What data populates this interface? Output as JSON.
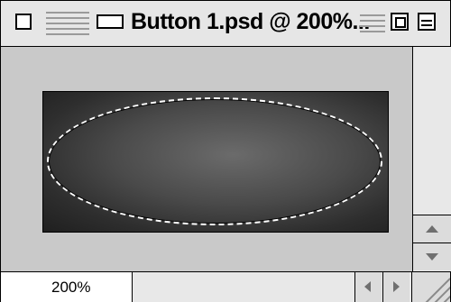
{
  "window": {
    "title": "Button 1.psd @ 200%...",
    "zoom_level": "200%"
  },
  "icons": {
    "close": "close-box-icon",
    "drag": "title-drag-lines-icon",
    "proxy": "document-proxy-icon",
    "zoom": "zoom-box-icon",
    "collapse": "collapse-box-icon",
    "scroll_up": "arrow-up-icon",
    "scroll_down": "arrow-down-icon",
    "scroll_left": "arrow-left-icon",
    "scroll_right": "arrow-right-icon",
    "grow": "resize-grip-icon"
  },
  "colors": {
    "window_bg": "#c9c9c9",
    "titlebar_bg": "#e6e6e6",
    "selection_marquee": "#ffffff",
    "image_center": "#6b6b6b",
    "image_edge": "#1f1f1f"
  }
}
